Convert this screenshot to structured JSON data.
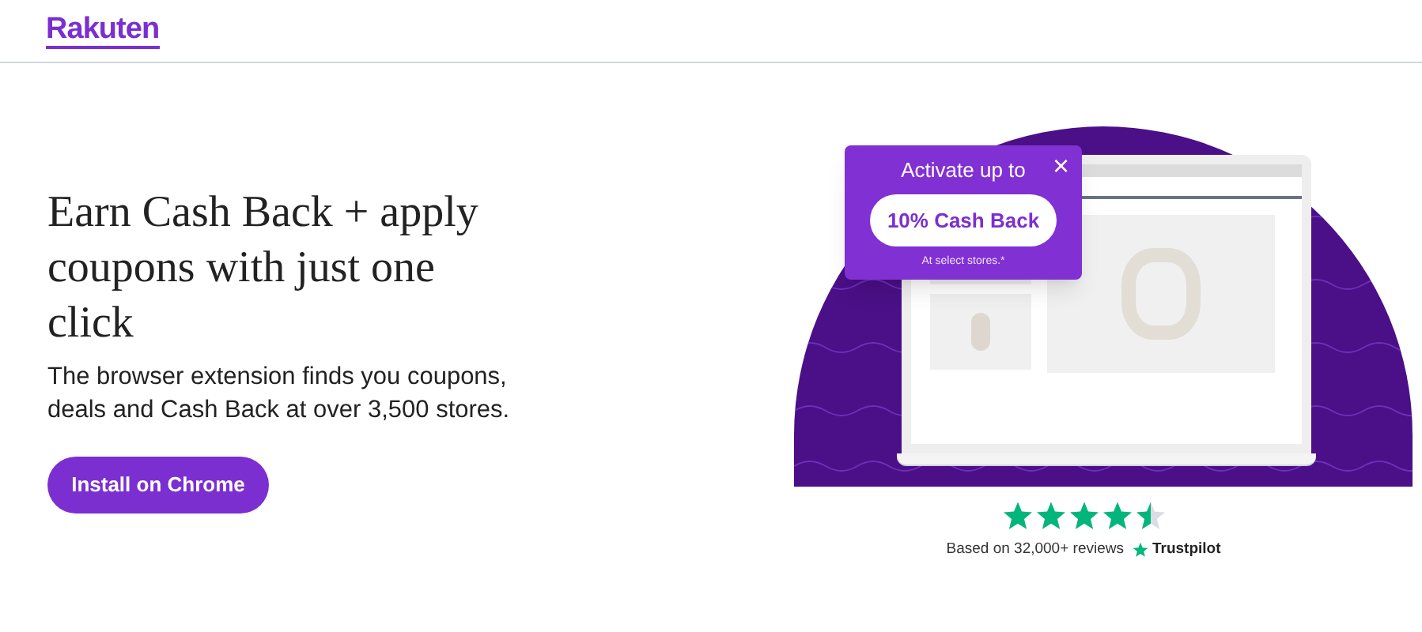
{
  "header": {
    "logo": "Rakuten"
  },
  "hero": {
    "heading": "Earn Cash Back + apply coupons with just one click",
    "text": "The browser extension finds you coupons, deals and Cash Back at over 3,500 stores.",
    "button": "Install on Chrome"
  },
  "popup": {
    "title": "Activate up to",
    "close": "×",
    "offer": "10% Cash Back",
    "note": "At select stores.*"
  },
  "rating": {
    "stars": 4.5,
    "text": "Based on 32,000+ reviews",
    "brand": "Trustpilot"
  }
}
